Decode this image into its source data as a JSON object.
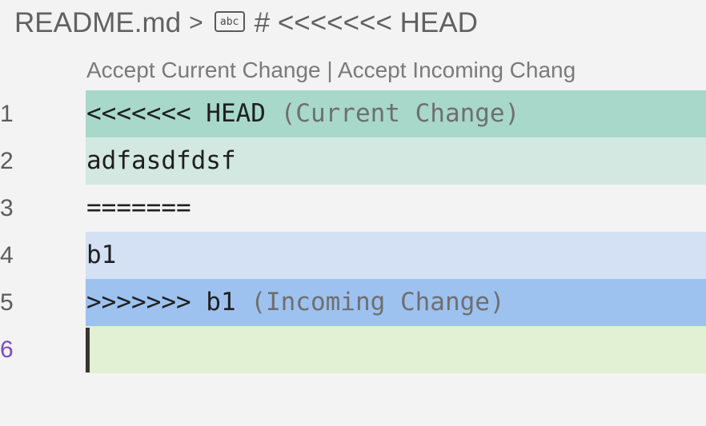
{
  "breadcrumb": {
    "file": "README.md",
    "separator": ">",
    "symbol_icon": "abc-icon",
    "symbol": "# <<<<<<< HEAD"
  },
  "codelens": {
    "accept_current": "Accept Current Change",
    "divider": "|",
    "accept_incoming": "Accept Incoming Chang"
  },
  "lines": [
    {
      "number": "1",
      "text": "<<<<<<< HEAD ",
      "annotation": "(Current Change)"
    },
    {
      "number": "2",
      "text": "adfasdfdsf"
    },
    {
      "number": "3",
      "text": "======="
    },
    {
      "number": "4",
      "text": "b1"
    },
    {
      "number": "5",
      "text": ">>>>>>> b1 ",
      "annotation": "(Incoming Change)"
    },
    {
      "number": "6",
      "text": ""
    }
  ],
  "colors": {
    "current_header": "#a8d8ca",
    "current_content": "#d3e8e1",
    "incoming_content": "#d4e1f4",
    "incoming_header": "#9dc2f0",
    "active_line": "#e2f0d3",
    "active_line_number": "#7c4bc2"
  }
}
